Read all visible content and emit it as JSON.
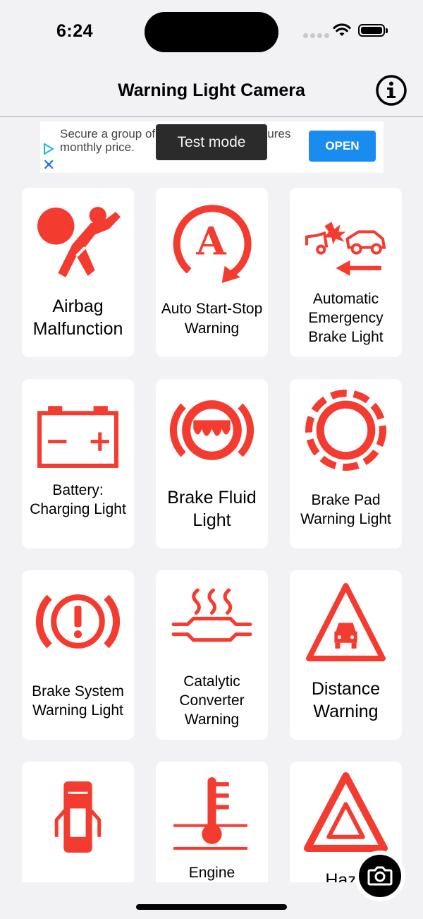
{
  "status_bar": {
    "time": "6:24"
  },
  "nav": {
    "title": "Warning Light Camera"
  },
  "ad": {
    "text": "Secure a group of Dashlane's core features monthly price.",
    "button": "OPEN"
  },
  "toast": {
    "text": "Test mode"
  },
  "cards": [
    {
      "label": "Airbag Malfunction",
      "icon": "airbag-icon"
    },
    {
      "label": "Auto Start-Stop Warning",
      "icon": "auto-start-stop-icon"
    },
    {
      "label": "Automatic Emergency Brake Light",
      "icon": "collision-warning-icon"
    },
    {
      "label": "Battery: Charging Light",
      "icon": "battery-icon"
    },
    {
      "label": "Brake Fluid Light",
      "icon": "brake-fluid-icon"
    },
    {
      "label": "Brake Pad Warning Light",
      "icon": "brake-pad-icon"
    },
    {
      "label": "Brake System Warning Light",
      "icon": "brake-system-icon"
    },
    {
      "label": "Catalytic Converter Warning",
      "icon": "catalytic-converter-icon"
    },
    {
      "label": "Distance Warning",
      "icon": "distance-warning-icon"
    },
    {
      "label": "",
      "icon": "door-open-icon"
    },
    {
      "label": "Engine",
      "icon": "engine-temperature-icon"
    },
    {
      "label": "Haza",
      "icon": "hazard-icon"
    }
  ],
  "colors": {
    "warning_red": "#f43b30",
    "ad_button": "#1a8cf0",
    "background": "#f2f2f4"
  }
}
